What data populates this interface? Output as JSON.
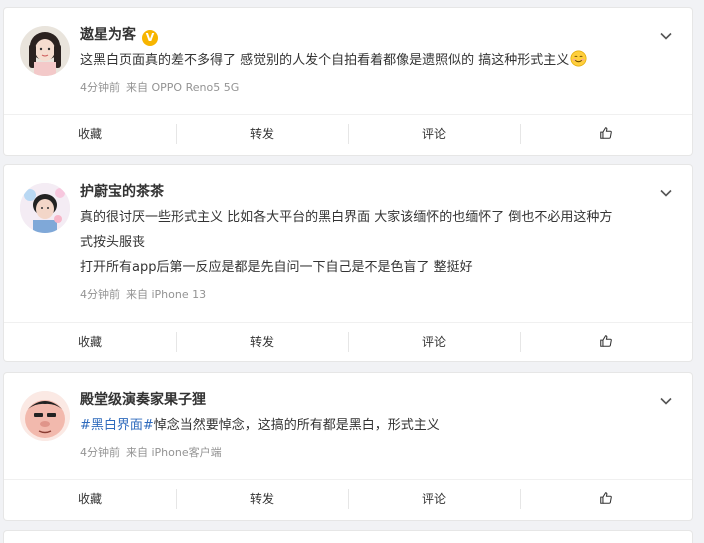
{
  "actions": {
    "favorite": "收藏",
    "repost": "转发",
    "comment": "评论",
    "like_icon": "thumbs-up-icon"
  },
  "posts": [
    {
      "user": "遨星为客",
      "verified": true,
      "lines": [
        "这黑白页面真的差不多得了 感觉别的人发个自拍看着都像是遗照似的 搞这种形式主义"
      ],
      "trailing_emoji": "smile-emoji",
      "time": "4分钟前",
      "source": "来自 OPPO Reno5 5G"
    },
    {
      "user": "护蔚宝的茶茶",
      "verified": false,
      "lines": [
        "真的很讨厌一些形式主义 比如各大平台的黑白界面 大家该缅怀的也缅怀了 倒也不必用这种方",
        "式按头服丧",
        "打开所有app后第一反应是都是先自问一下自己是不是色盲了 整挺好"
      ],
      "time": "4分钟前",
      "source": "来自 iPhone 13"
    },
    {
      "user": "殿堂级演奏家果子狸",
      "verified": false,
      "hashtag": "#黑白界面#",
      "text_after_hashtag": "悼念当然要悼念，这搞的所有都是黑白，形式主义",
      "time": "4分钟前",
      "source": "来自 iPhone客户端"
    }
  ],
  "colors": {
    "background": "#f1f2f5",
    "hashtag": "#2f6bbd",
    "meta": "#939393",
    "verified": "#f7b500"
  }
}
